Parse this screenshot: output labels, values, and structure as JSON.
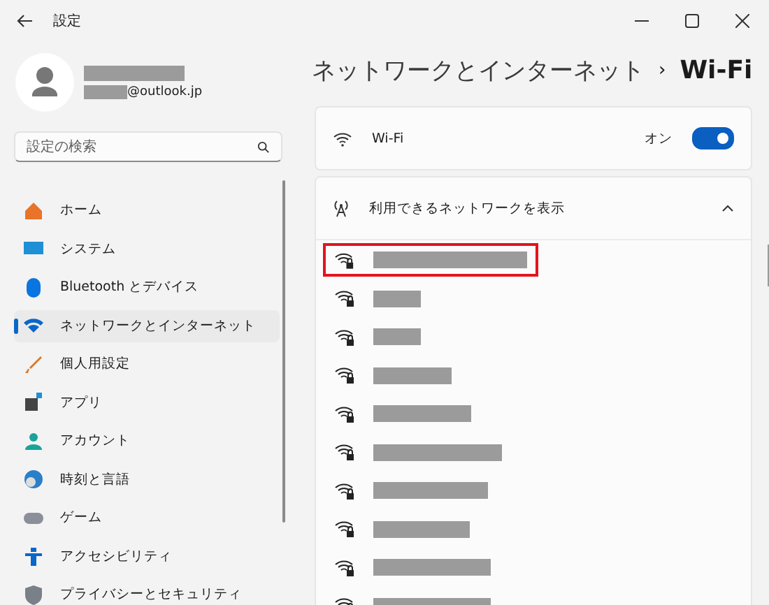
{
  "window": {
    "title": "設定"
  },
  "profile": {
    "email_suffix": "@outlook.jp"
  },
  "search": {
    "placeholder": "設定の検索"
  },
  "sidebar": {
    "items": [
      {
        "label": "ホーム",
        "kind": "home",
        "selected": false
      },
      {
        "label": "システム",
        "kind": "system",
        "selected": false
      },
      {
        "label": "Bluetooth とデバイス",
        "kind": "bluetooth",
        "selected": false
      },
      {
        "label": "ネットワークとインターネット",
        "kind": "network",
        "selected": true
      },
      {
        "label": "個人用設定",
        "kind": "brush",
        "selected": false
      },
      {
        "label": "アプリ",
        "kind": "apps",
        "selected": false
      },
      {
        "label": "アカウント",
        "kind": "account",
        "selected": false
      },
      {
        "label": "時刻と言語",
        "kind": "time",
        "selected": false
      },
      {
        "label": "ゲーム",
        "kind": "game",
        "selected": false
      },
      {
        "label": "アクセシビリティ",
        "kind": "accessibility",
        "selected": false
      },
      {
        "label": "プライバシーとセキュリティ",
        "kind": "shield",
        "selected": false
      }
    ]
  },
  "breadcrumb": {
    "parent": "ネットワークとインターネット",
    "separator": "›",
    "current": "Wi-Fi"
  },
  "wifi_card": {
    "label": "Wi-Fi",
    "state_label": "オン",
    "on": true
  },
  "networks_card": {
    "label": "利用できるネットワークを表示",
    "expanded": true,
    "networks": [
      {
        "highlighted": true
      },
      {
        "highlighted": false
      },
      {
        "highlighted": false
      },
      {
        "highlighted": false
      },
      {
        "highlighted": false
      },
      {
        "highlighted": false
      },
      {
        "highlighted": false
      },
      {
        "highlighted": false
      },
      {
        "highlighted": false
      },
      {
        "highlighted": false
      }
    ]
  }
}
